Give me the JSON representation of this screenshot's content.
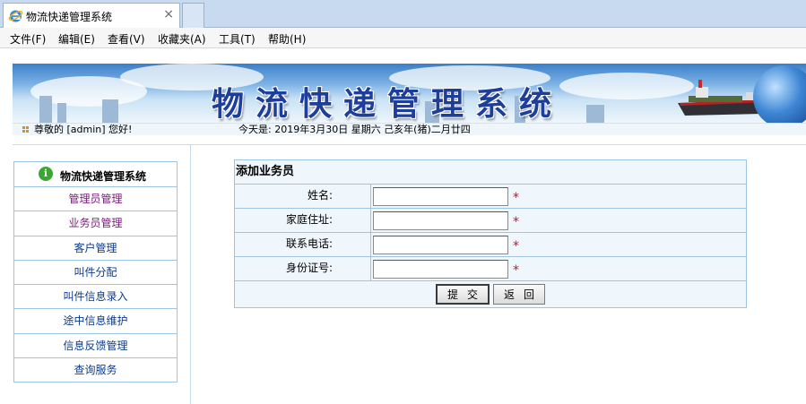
{
  "browser": {
    "tab_title": "物流快递管理系统",
    "close_glyph": "×"
  },
  "menu": [
    "文件(F)",
    "编辑(E)",
    "查看(V)",
    "收藏夹(A)",
    "工具(T)",
    "帮助(H)"
  ],
  "banner": {
    "title": "物流快递管理系统"
  },
  "status": {
    "greeting": "尊敬的 [admin] 您好!",
    "today": "今天是:  2019年3月30日  星期六  己亥年(猪)二月廿四"
  },
  "sidebar": {
    "title": "物流快递管理系统",
    "items": [
      "管理员管理",
      "业务员管理",
      "客户管理",
      "叫件分配",
      "叫件信息录入",
      "途中信息维护",
      "信息反馈管理",
      "查询服务"
    ]
  },
  "form": {
    "title": "添加业务员",
    "fields": [
      {
        "label": "姓名:",
        "value": ""
      },
      {
        "label": "家庭住址:",
        "value": ""
      },
      {
        "label": "联系电话:",
        "value": ""
      },
      {
        "label": "身份证号:",
        "value": ""
      }
    ],
    "required_mark": "*",
    "submit_label": "提交",
    "back_label": "返回"
  },
  "colors": {
    "accent": "#1d3f9a",
    "link": "#0d3b8a",
    "visited_link": "#7a1b7a",
    "required": "#d0121b",
    "panel_bg": "#eff6fc",
    "border": "#9ec4e4"
  }
}
